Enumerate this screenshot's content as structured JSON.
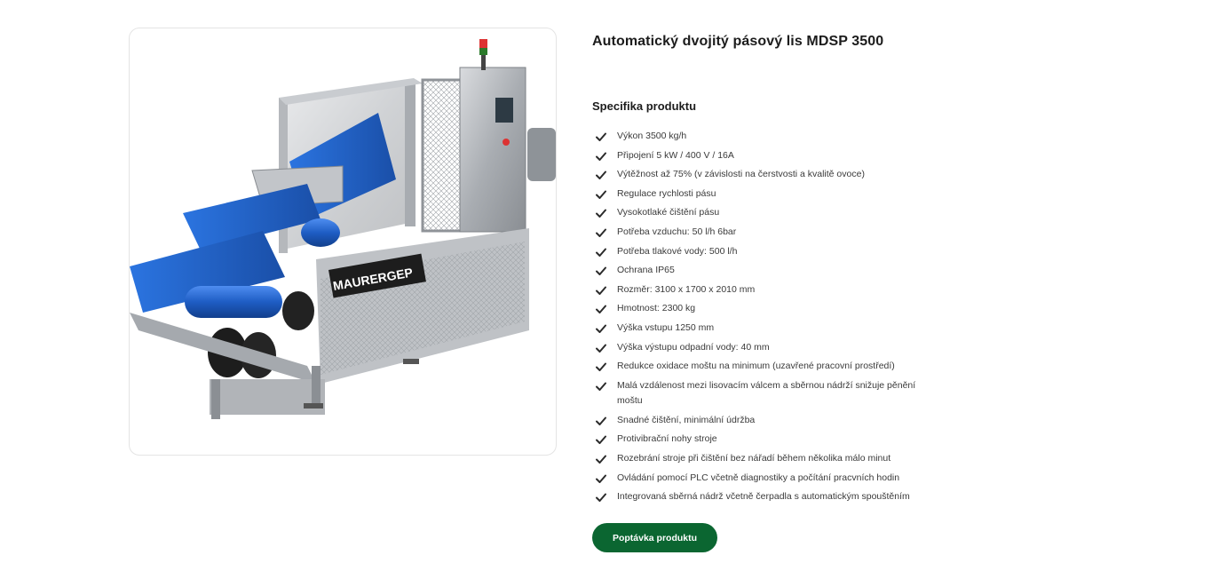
{
  "product": {
    "title": "Automatický dvojitý pásový lis MDSP 3500",
    "image_alt": "Automatický dvojitý pásový lis MDSP 3500",
    "brand_logo": "MAURERGEP"
  },
  "specs": {
    "heading": "Specifika produktu",
    "icon": "check-icon",
    "items": [
      "Výkon 3500 kg/h",
      "Připojení 5 kW / 400 V / 16A",
      "Výtěžnost až 75% (v závislosti na čerstvosti a kvalitě ovoce)",
      "Regulace rychlosti pásu",
      "Vysokotlaké čištění pásu",
      "Potřeba vzduchu: 50 l/h 6bar",
      "Potřeba tlakové vody: 500 l/h",
      "Ochrana IP65",
      "Rozměr: 3100 x 1700 x 2010 mm",
      "Hmotnost: 2300 kg",
      "Výška vstupu 1250 mm",
      "Výška výstupu odpadní vody: 40 mm",
      "Redukce oxidace moštu na minimum (uzavřené pracovní prostředí)",
      "Malá vzdálenost mezi lisovacím válcem a sběrnou nádrží snižuje pěnění moštu",
      "Snadné čištění, minimální údržba",
      "Protivibrační nohy stroje",
      "Rozebrání stroje při čištění bez nářadí během několika málo minut",
      "Ovládání pomocí PLC včetně diagnostiky a počítání pracvních hodin",
      "Integrovaná sběrná nádrž včetně čerpadla s automatickým spouštěním"
    ]
  },
  "cta": {
    "label": "Poptávka produktu"
  },
  "colors": {
    "accent": "#0b6631",
    "belt": "#1f63c9",
    "steel": "#b9bcc0"
  }
}
